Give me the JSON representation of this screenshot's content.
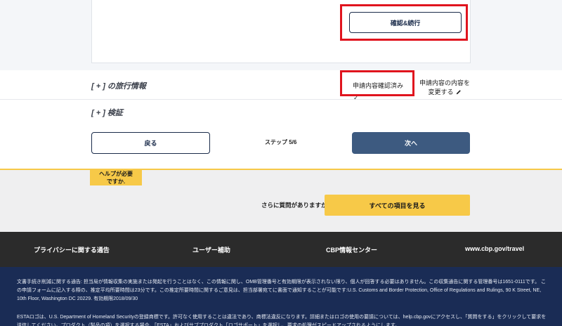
{
  "confirm": {
    "label": "確認&続行"
  },
  "sections": {
    "travel": {
      "title": "[ + ] の旅行情報",
      "status": "申請内容確認済み",
      "check": "✓",
      "change_line1": "申請内容の内容を",
      "change_line2": "変更する"
    },
    "verify": {
      "title": "[ + ] 検証"
    }
  },
  "nav": {
    "back": "戻る",
    "step": "ステップ 5/6",
    "next": "次へ"
  },
  "help": {
    "tab_line1": "ヘルプが必要",
    "tab_line2": "ですか.",
    "question": "さらに質問がありますか。",
    "faq_button": "すべての項目を見る"
  },
  "footer": {
    "links": [
      "プライバシーに関する通告",
      "ユーザー補助",
      "CBP情報センター",
      "www.cbp.gov/travel"
    ],
    "legal1": "文書手続き削減に関する通告: 担当局が情報収集の実施または発起を行うことはなく、この情報に関し、OMB管理番号と有効期限が表示されない限り、個人が回答する必要はありません。この収集通告に関する管理番号は1651-0111です。 この申請フォームに記入する際の、推定平均所要時間は23分です。この推定所要時間に関するご意見は、担当部署宛てに書面で通知することが可能です:U.S. Customs and Border Protection, Office of Regulations and Rulings, 90 K Street, NE, 10th Floor, Washington DC 20229. 有効期限2018/09/30",
    "legal2": "ESTAロゴは、U.S. Department of Homeland Securityの登録商標です。許可なく使用することは違法であり、商標法違反になります。詳細またはロゴの使用の要請については、help.cbp.govにアクセスし、「質問をする」をクリックして要求を送信してください。プロダクト（製品の項）を選択する場合、「ESTA」およびサブプロダクト「ロゴサポート」を選択し、要求の処理がスピードアップされるようにします。"
  },
  "colors": {
    "highlight": "#e0141e",
    "primary": "#3d5a80",
    "accent": "#f7c948",
    "footer_dark": "#2b2b2b",
    "footer_navy": "#1a2c55"
  }
}
